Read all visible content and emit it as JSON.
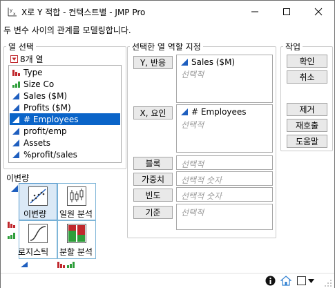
{
  "window": {
    "title": "X로 Y 적합 - 컨텍스트별 - JMP Pro"
  },
  "subtitle": "두 변수 사이의 관계를 모델링합니다.",
  "column_select": {
    "label": "열 선택",
    "count": "8개 열",
    "columns": [
      {
        "name": "Type",
        "type": "nominal"
      },
      {
        "name": "Size Co",
        "type": "ordinal"
      },
      {
        "name": "Sales ($M)",
        "type": "continuous"
      },
      {
        "name": "Profits ($M)",
        "type": "continuous"
      },
      {
        "name": "# Employees",
        "type": "continuous",
        "selected": true
      },
      {
        "name": "profit/emp",
        "type": "continuous"
      },
      {
        "name": "Assets",
        "type": "continuous"
      },
      {
        "name": "%profit/sales",
        "type": "continuous"
      }
    ]
  },
  "roles": {
    "label": "선택한 열 역할 지정",
    "y_button": "Y, 반응",
    "y_value": "Sales ($M)",
    "y_placeholder": "선택적",
    "x_button": "X, 요인",
    "x_value": "# Employees",
    "x_placeholder": "선택적",
    "block_button": "블록",
    "block_placeholder": "선택적",
    "weight_button": "가중치",
    "weight_placeholder": "선택적 숫자",
    "freq_button": "빈도",
    "freq_placeholder": "선택적 숫자",
    "by_button": "기준",
    "by_placeholder": "선택적"
  },
  "action": {
    "label": "작업",
    "ok": "확인",
    "cancel": "취소",
    "remove": "제거",
    "recall": "재호출",
    "help": "도움말"
  },
  "analysis": {
    "label": "이변량",
    "tiles": [
      {
        "label": "이변량",
        "icon": "bivariate-icon",
        "selected": true
      },
      {
        "label": "일원 분석",
        "icon": "oneway-icon"
      },
      {
        "label": "로지스틱",
        "icon": "logistic-icon"
      },
      {
        "label": "분할 분석",
        "icon": "contingency-icon"
      }
    ]
  },
  "colors": {
    "selection": "#0a64c8",
    "continuous": "#1f5fbf",
    "nominal": "#c0282d",
    "ordinal": "#2e9e3a"
  }
}
